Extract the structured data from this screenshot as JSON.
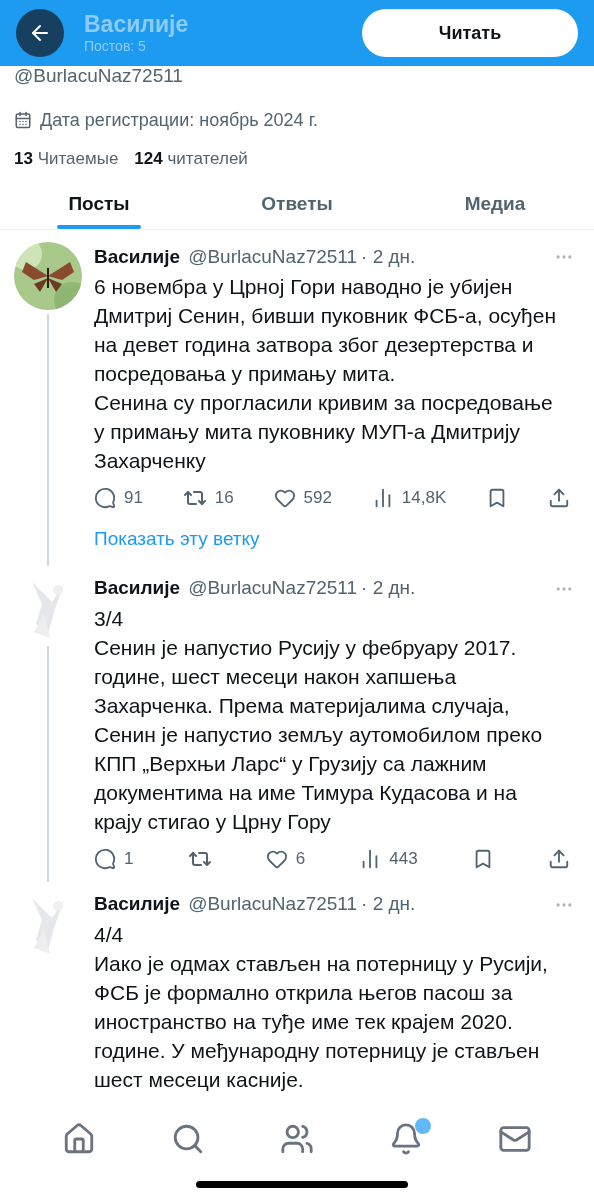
{
  "header": {
    "title": "Василије",
    "subtitle": "Постов: 5",
    "follow_button": "Читать"
  },
  "profile": {
    "handle": "@BurlacuNaz72511",
    "joined": "Дата регистрации: ноябрь 2024 г.",
    "following_count": "13",
    "following_label": "Читаемые",
    "followers_count": "124",
    "followers_label": "читателей"
  },
  "tabs": [
    {
      "label": "Посты",
      "selected": true
    },
    {
      "label": "Ответы",
      "selected": false
    },
    {
      "label": "Медиа",
      "selected": false
    }
  ],
  "posts": [
    {
      "name": "Василије",
      "handle": "@BurlacuNaz72511",
      "time": "· 2 дн.",
      "avatar": {
        "faded": false
      },
      "paragraphs": [
        "6 новембра у Црној Гори наводно је убијен Дмитриј Сенин, бивши пуковник ФСБ-а, осуђен на девет година затвора због дезертерства и посредовања у примању мита.",
        "Сенина су прогласили кривим за посредовање у примању мита пуковнику МУП-а Дмитрију Захарченку"
      ],
      "stats": {
        "replies": "91",
        "reposts": "16",
        "likes": "592",
        "views": "14,8K"
      },
      "thread_link": "Показать эту ветку"
    },
    {
      "name": "Василије",
      "handle": "@BurlacuNaz72511",
      "time": "· 2 дн.",
      "avatar": {
        "faded": true
      },
      "paragraphs": [
        "3/4",
        "Сенин је напустио Русију у фебруару 2017. године, шест месеци након хапшења Захарченка. Према материјалима случаја, Сенин је напустио земљу аутомобилом преко КПП „Верхњи Ларс“ у Грузију са лажним документима на име Тимура Кудасова и на крају стигао у Црну Гору"
      ],
      "stats": {
        "replies": "1",
        "likes": "6",
        "views": "443"
      }
    },
    {
      "name": "Василије",
      "handle": "@BurlacuNaz72511",
      "time": "· 2 дн.",
      "avatar": {
        "faded": true
      },
      "paragraphs": [
        "4/4",
        "Иако је одмах стављен на потерницу у Русији, ФСБ је формално открила његов пасош за иностранство на туђе име тек крајем 2020. године. У међународну потерницу је стављен шест месеци касније."
      ]
    }
  ],
  "bottom_nav": [
    {
      "kind": "home"
    },
    {
      "kind": "search"
    },
    {
      "kind": "communities"
    },
    {
      "kind": "notifications",
      "badge": true
    },
    {
      "kind": "messages"
    }
  ]
}
